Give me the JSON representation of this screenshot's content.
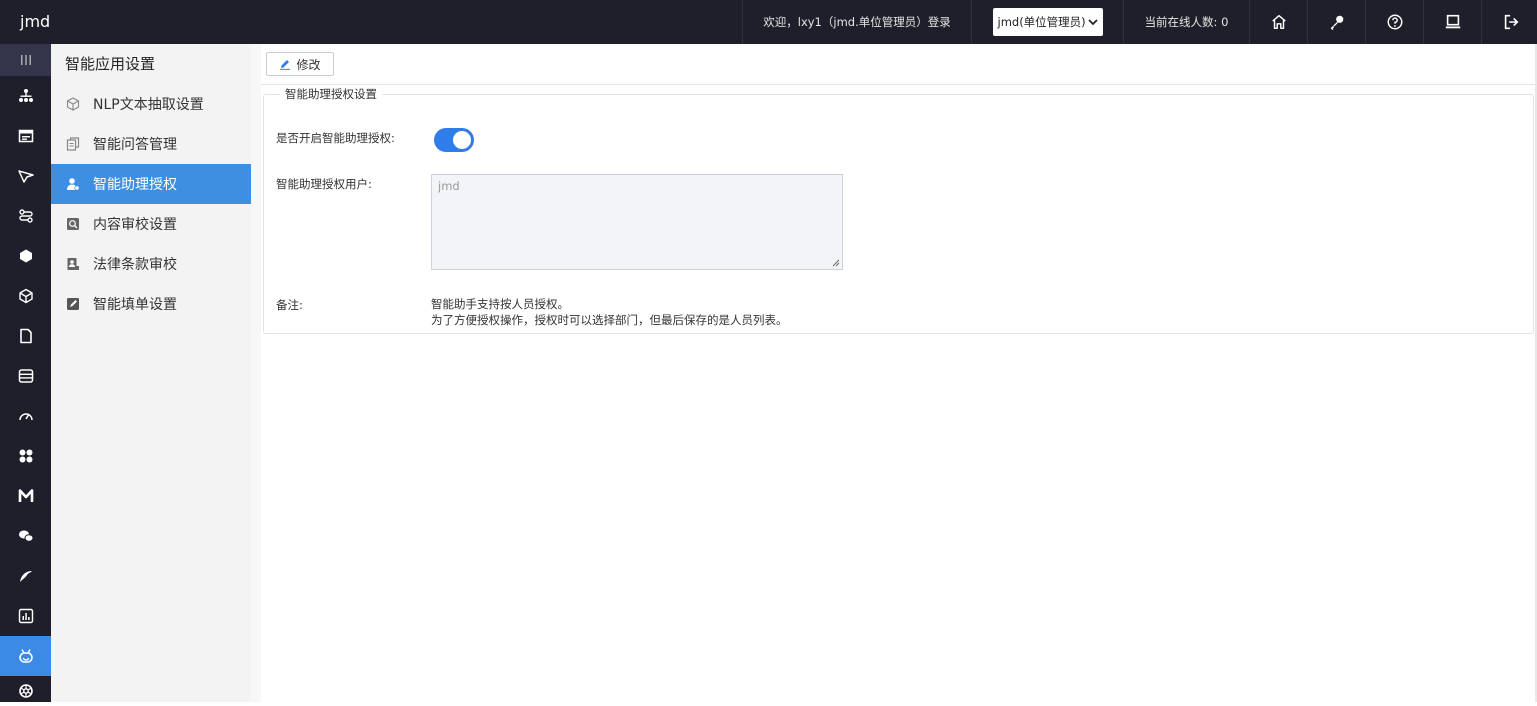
{
  "header": {
    "brand": "jmd",
    "welcome": "欢迎，lxy1（jmd.单位管理员）登录",
    "unit_select": "jmd(单位管理员)",
    "online_count": "当前在线人数: 0",
    "icons": [
      "home-icon",
      "key-icon",
      "help-icon",
      "monitor-icon",
      "logout-icon"
    ]
  },
  "rail": {
    "icons": [
      "menu-icon",
      "org-icon",
      "calendar-icon",
      "send-icon",
      "flow-icon",
      "hexagon-icon",
      "cube-icon",
      "document-icon",
      "database-icon",
      "gauge-icon",
      "grid-icon",
      "m-icon",
      "chat-icon",
      "signature-icon",
      "chart-icon",
      "robot-icon",
      "settings-icon"
    ],
    "active": "robot-icon"
  },
  "submenu": {
    "title": "智能应用设置",
    "items": [
      {
        "label": "NLP文本抽取设置",
        "icon": "cube-outline-icon"
      },
      {
        "label": "智能问答管理",
        "icon": "qa-icon"
      },
      {
        "label": "智能助理授权",
        "icon": "user-auth-icon",
        "active": true
      },
      {
        "label": "内容审校设置",
        "icon": "audit-icon"
      },
      {
        "label": "法律条款审校",
        "icon": "law-icon"
      },
      {
        "label": "智能填单设置",
        "icon": "form-icon"
      }
    ]
  },
  "toolbar": {
    "edit_label": "修改"
  },
  "panel": {
    "legend": "智能助理授权设置",
    "enable_label": "是否开启智能助理授权:",
    "enabled": true,
    "users_label": "智能助理授权用户:",
    "users_value": "jmd",
    "remark_label": "备注:",
    "remark_line1": "智能助手支持按人员授权。",
    "remark_line2": "为了方便授权操作，授权时可以选择部门，但最后保存的是人员列表。"
  },
  "colors": {
    "topbar": "#1f1f2b",
    "accent": "#3d8fe2",
    "toggle": "#2f7de8"
  }
}
